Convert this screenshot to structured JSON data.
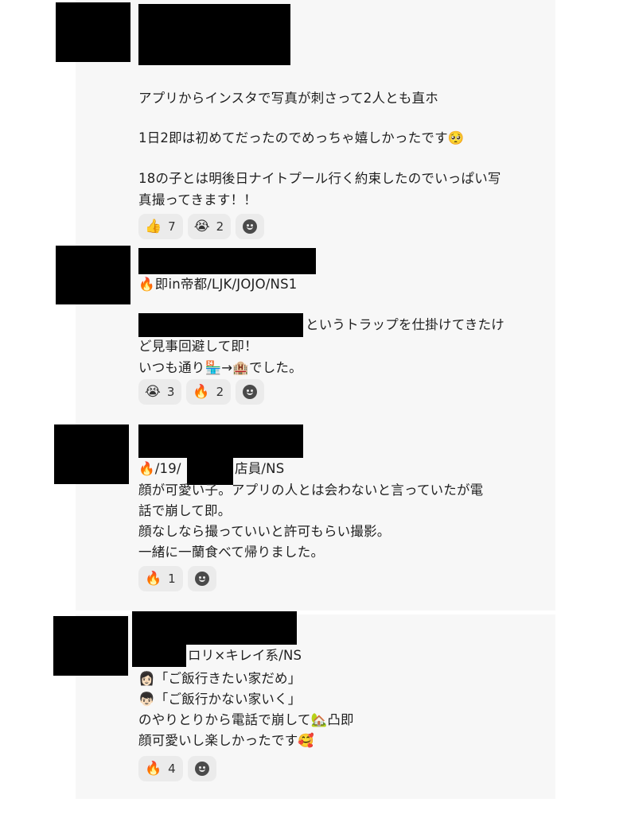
{
  "posts": [
    {
      "lines": [
        "アプリからインスタで写真が刺さって2人とも直ホ",
        "1日2即は初めてだったのでめっちゃ嬉しかったです🥺",
        "18の子とは明後日ナイトプール行く約束したのでいっぱい写",
        "真撮ってきます！！"
      ],
      "reactions": [
        {
          "emoji": "👍",
          "count": "7"
        },
        {
          "emoji": "😭",
          "count": "2"
        }
      ]
    },
    {
      "meta": "🔥即in帝都/LJK/JOJO/NS1",
      "lines": [
        "というトラップを仕掛けてきたけ",
        "ど見事回避して即！",
        "いつも通り🏪→🏨でした。"
      ],
      "reactions": [
        {
          "emoji": "😭",
          "count": "3"
        },
        {
          "emoji": "🔥",
          "count": "2"
        }
      ]
    },
    {
      "meta_prefix": "🔥/19/",
      "meta_suffix": "店員/NS",
      "lines": [
        "顔が可愛い子。アプリの人とは会わないと言っていたが電",
        "話で崩して即。",
        "顔なしなら撮っていいと許可もらい撮影。",
        "一緒に一蘭食べて帰りました。"
      ],
      "reactions": [
        {
          "emoji": "🔥",
          "count": "1"
        }
      ]
    },
    {
      "meta": "ロリ×キレイ系/NS",
      "lines": [
        "👩🏻「ご飯行きたい家だめ」",
        "👦🏻「ご飯行かない家いく」",
        "のやりとりから電話で崩して🏡凸即",
        "顔可愛いし楽しかったです🥰"
      ],
      "reactions": [
        {
          "emoji": "🔥",
          "count": "4"
        }
      ]
    }
  ],
  "icons": {
    "add_reaction": "smiley-icon"
  }
}
